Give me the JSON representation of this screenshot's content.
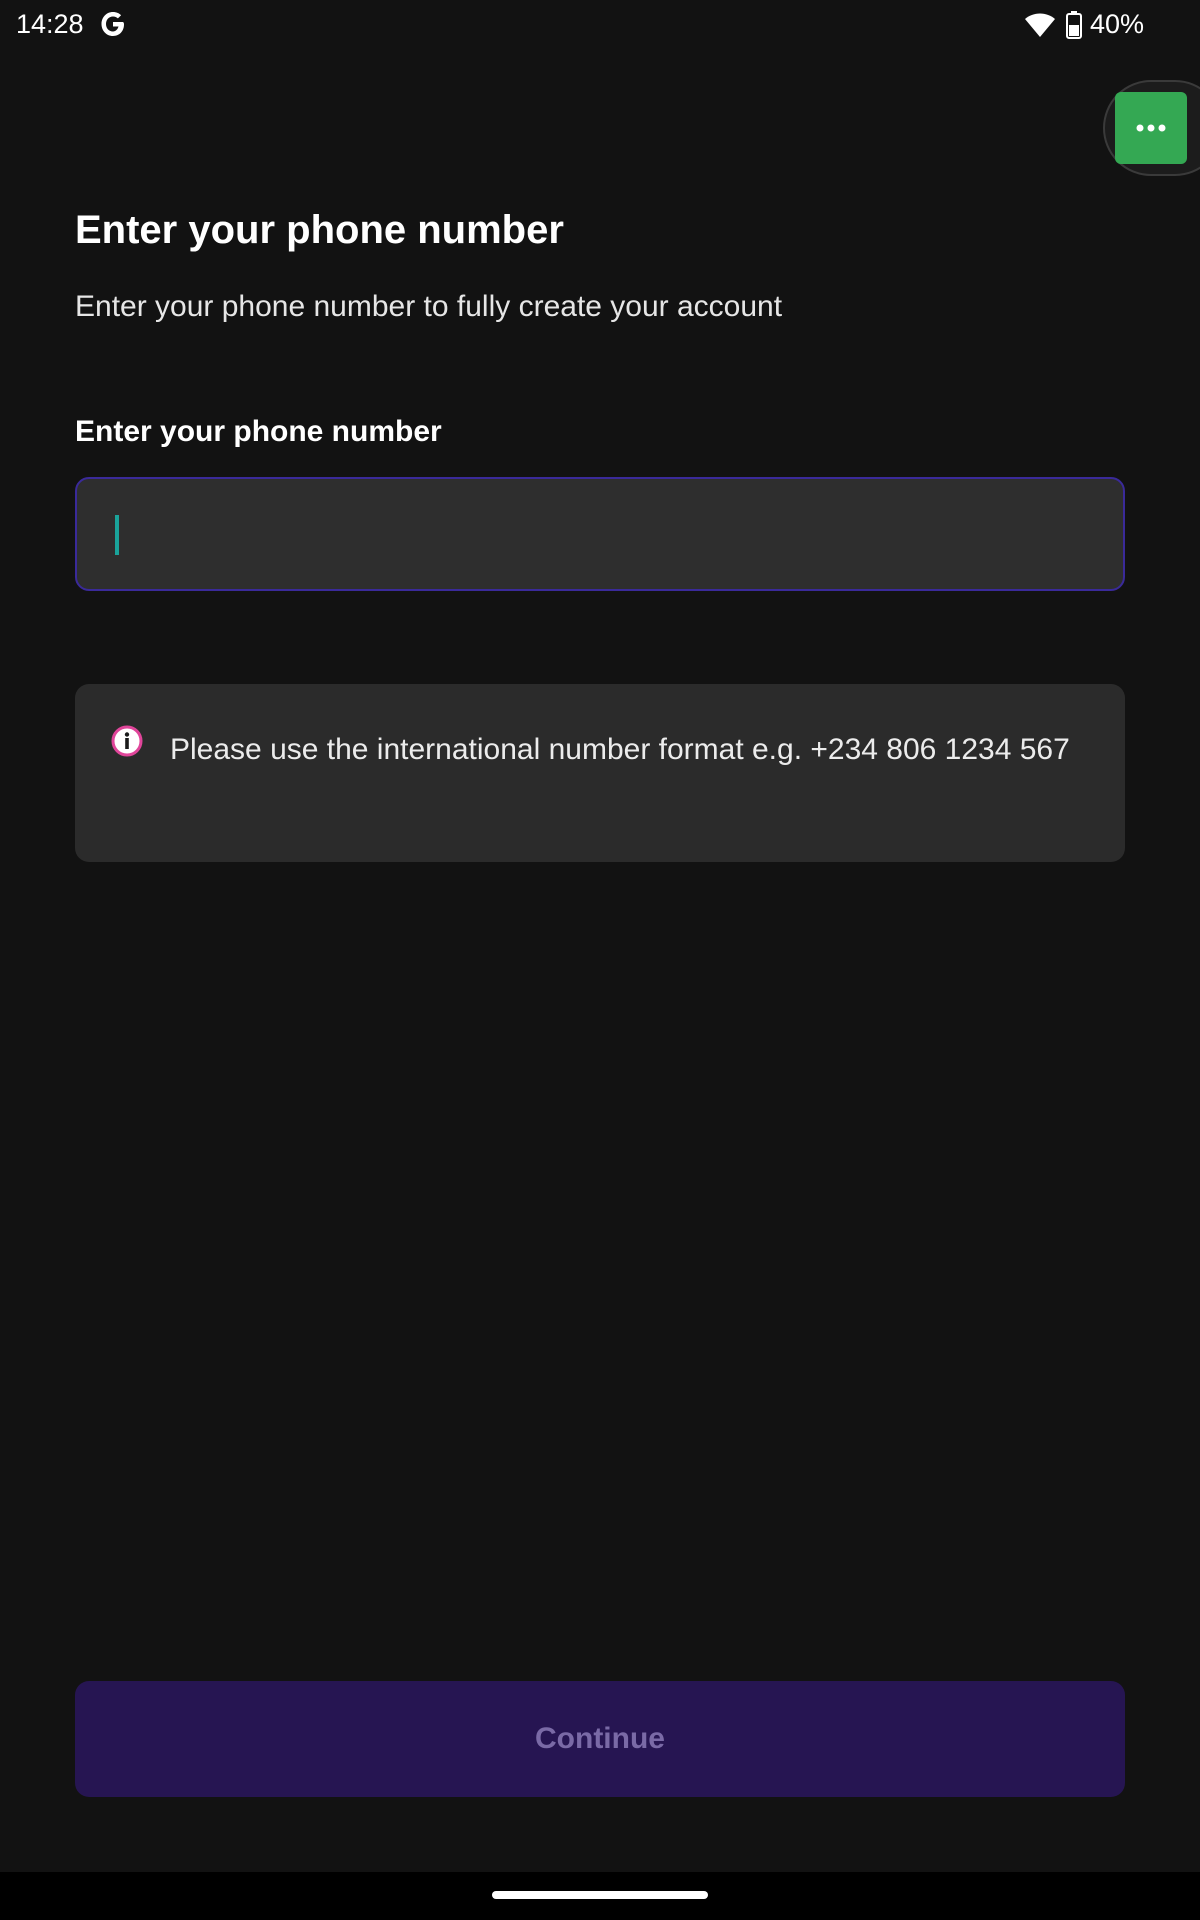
{
  "status_bar": {
    "time": "14:28",
    "battery": "40%",
    "icons": [
      "google-g-icon",
      "wifi-icon",
      "battery-icon"
    ]
  },
  "overlay": {
    "icon": "more-horizontal-icon",
    "accent": "#34a853"
  },
  "page": {
    "title": "Enter your phone number",
    "subtitle": "Enter your phone number to fully create your account"
  },
  "phone_field": {
    "label": "Enter your phone number",
    "value": "",
    "placeholder": ""
  },
  "info": {
    "icon": "info-icon",
    "text": "Please use the international number format e.g. +234 806 1234 567"
  },
  "actions": {
    "continue_label": "Continue",
    "continue_disabled": true
  },
  "colors": {
    "background": "#121212",
    "input_border": "#3a2a9a",
    "button_bg": "#261552",
    "button_text": "#7a6aa6",
    "info_icon": "#e0459a"
  }
}
